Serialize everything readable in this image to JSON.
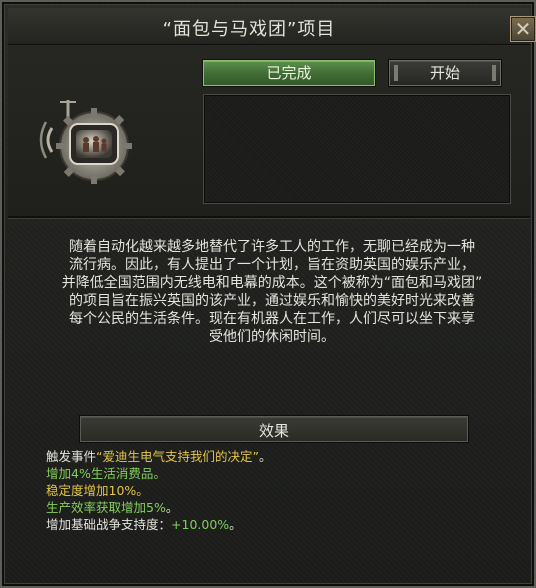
{
  "window": {
    "title": "“面包与马戏团”项目",
    "close_icon": "close-x-icon"
  },
  "actions": {
    "done_label": "已完成",
    "start_label": "开始",
    "done_color": "#4a7a3d"
  },
  "emblem": {
    "icon": "radio-television-emblem-icon"
  },
  "description": "随着自动化越来越多地替代了许多工人的工作，无聊已经成为一种\n流行病。因此，有人提出了一个计划，旨在资助英国的娱乐产业，\n并降低全国范围内无线电和电幕的成本。这个被称为“面包和马戏团”\n的项目旨在振兴英国的该产业，通过娱乐和愉快的美好时光来改善\n每个公民的生活条件。现在有机器人在工作，人们尽可以坐下来享\n受他们的休闲时间。",
  "effects": {
    "header": "效果",
    "trigger_prefix": "触发事件",
    "trigger_event": "“爱迪生电气支持我们的决定”",
    "trigger_suffix": "。",
    "line1": "增加4%生活消费品。",
    "line2": "稳定度增加10%。",
    "line3_a": "生产效率获取",
    "line3_b": "增加5%",
    "line3_c": "。",
    "line4_label": "增加基础战争支持度：",
    "line4_value": "+10.00%",
    "line4_suffix": "。"
  },
  "colors": {
    "positive_green": "#84cf5a",
    "event_yellow": "#e2c548",
    "text": "#e4e4dc"
  }
}
